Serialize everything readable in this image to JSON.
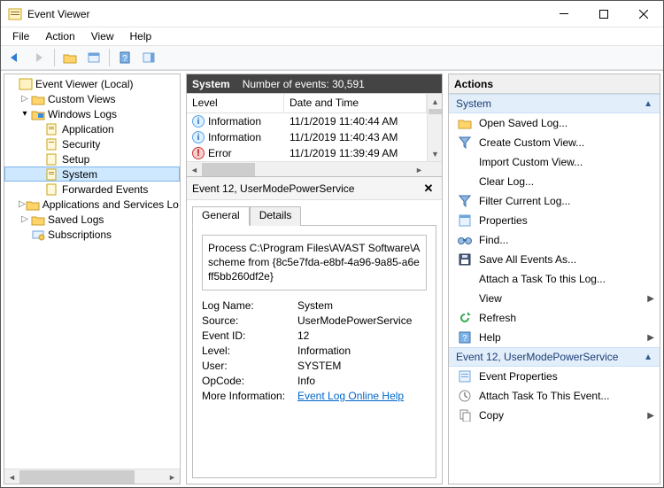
{
  "window": {
    "title": "Event Viewer"
  },
  "menubar": [
    "File",
    "Action",
    "View",
    "Help"
  ],
  "tree": {
    "root": "Event Viewer (Local)",
    "custom_views": "Custom Views",
    "windows_logs": "Windows Logs",
    "application": "Application",
    "security": "Security",
    "setup": "Setup",
    "system": "System",
    "forwarded": "Forwarded Events",
    "apps_services": "Applications and Services Lo",
    "saved_logs": "Saved Logs",
    "subscriptions": "Subscriptions"
  },
  "grid": {
    "title": "System",
    "count_label": "Number of events: 30,591",
    "cols": {
      "level": "Level",
      "dt": "Date and Time"
    },
    "rows": [
      {
        "level": "Information",
        "lvl": "info",
        "dt": "11/1/2019 11:40:44 AM"
      },
      {
        "level": "Information",
        "lvl": "info",
        "dt": "11/1/2019 11:40:43 AM"
      },
      {
        "level": "Error",
        "lvl": "err",
        "dt": "11/1/2019 11:39:49 AM"
      }
    ]
  },
  "detail": {
    "header": "Event 12, UserModePowerService",
    "tabs": {
      "general": "General",
      "details": "Details"
    },
    "msg1": "Process C:\\Program Files\\AVAST Software\\A",
    "msg2": "scheme from {8c5e7fda-e8bf-4a96-9a85-a6e",
    "msg3": "ff5bb260df2e}",
    "kv": {
      "logname_k": "Log Name:",
      "logname_v": "System",
      "source_k": "Source:",
      "source_v": "UserModePowerService",
      "eventid_k": "Event ID:",
      "eventid_v": "12",
      "level_k": "Level:",
      "level_v": "Information",
      "user_k": "User:",
      "user_v": "SYSTEM",
      "opcode_k": "OpCode:",
      "opcode_v": "Info",
      "more_k": "More Information:",
      "more_v": "Event Log Online Help"
    }
  },
  "actions": {
    "title": "Actions",
    "group1": "System",
    "open_saved": "Open Saved Log...",
    "create_view": "Create Custom View...",
    "import_view": "Import Custom View...",
    "clear_log": "Clear Log...",
    "filter_log": "Filter Current Log...",
    "properties": "Properties",
    "find": "Find...",
    "save_all": "Save All Events As...",
    "attach_task": "Attach a Task To this Log...",
    "view": "View",
    "refresh": "Refresh",
    "help": "Help",
    "group2": "Event 12, UserModePowerService",
    "event_props": "Event Properties",
    "attach_task2": "Attach Task To This Event...",
    "copy": "Copy"
  }
}
